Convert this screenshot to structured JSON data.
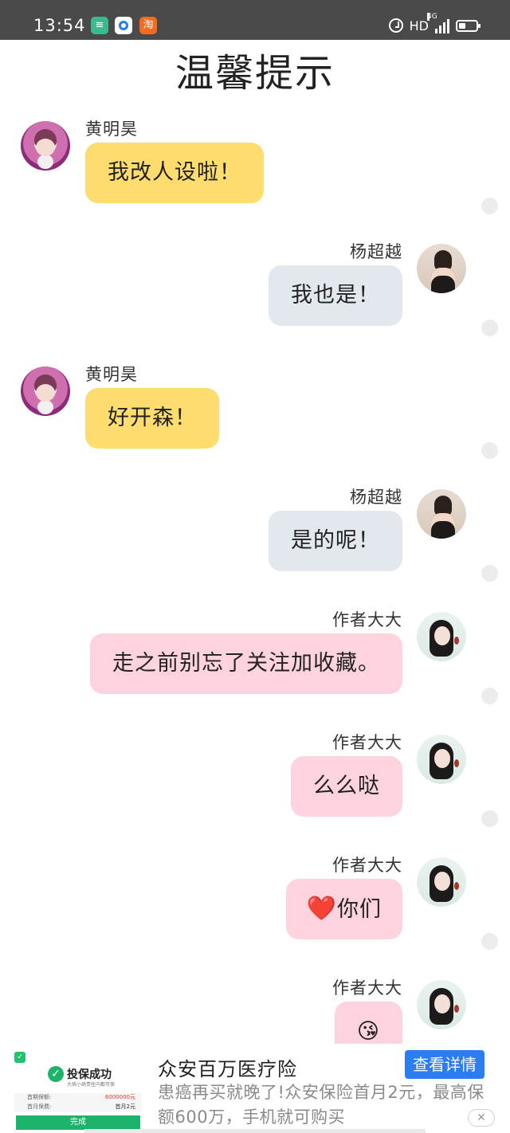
{
  "status_bar": {
    "time": "13:54",
    "app_icons": [
      {
        "name": "green-app-icon",
        "glyph": "≡",
        "color": "#3cb98d"
      },
      {
        "name": "blue-app-icon",
        "glyph": "",
        "color": "#2a7de1"
      },
      {
        "name": "taobao-app-icon",
        "glyph": "淘",
        "color": "#f46a1f"
      }
    ],
    "hd": "HD",
    "network": "4G"
  },
  "title": "温馨提示",
  "messages": [
    {
      "sender": "黄明昊",
      "side": "left",
      "avatar": "huang",
      "text": "我改人设啦！",
      "bubble_color": "#fedc6e"
    },
    {
      "sender": "杨超越",
      "side": "right",
      "avatar": "yang",
      "text": "我也是！",
      "bubble_color": "#e3e8ef"
    },
    {
      "sender": "黄明昊",
      "side": "left",
      "avatar": "huang",
      "text": "好开森！",
      "bubble_color": "#fedc6e"
    },
    {
      "sender": "杨超越",
      "side": "right",
      "avatar": "yang",
      "text": "是的呢！",
      "bubble_color": "#e3e8ef"
    },
    {
      "sender": "作者大大",
      "side": "right",
      "avatar": "author",
      "text": "走之前别忘了关注加收藏。",
      "bubble_color": "#fdd3de"
    },
    {
      "sender": "作者大大",
      "side": "right",
      "avatar": "author",
      "text": "么么哒",
      "bubble_color": "#fdd3de"
    },
    {
      "sender": "作者大大",
      "side": "right",
      "avatar": "author",
      "emoji": "❤️",
      "text": "你们",
      "bubble_color": "#fdd3de"
    },
    {
      "sender": "作者大大",
      "side": "right",
      "avatar": "author",
      "emoji": "😘",
      "text": "",
      "bubble_color": "#fdd3de"
    }
  ],
  "ad": {
    "thumb": {
      "title": "投保成功",
      "subtitle": "大病小病责任内都可保",
      "row1_label": "首期保额:",
      "row1_value": "6000000元",
      "row2_label": "首月保费:",
      "row2_value": "首月2元",
      "button": "完成"
    },
    "title": "众安百万医疗险",
    "button": "查看详情",
    "desc": "患癌再买就晚了!众安保险首月2元，最高保额600万，手机就可购买",
    "close": "✕"
  }
}
